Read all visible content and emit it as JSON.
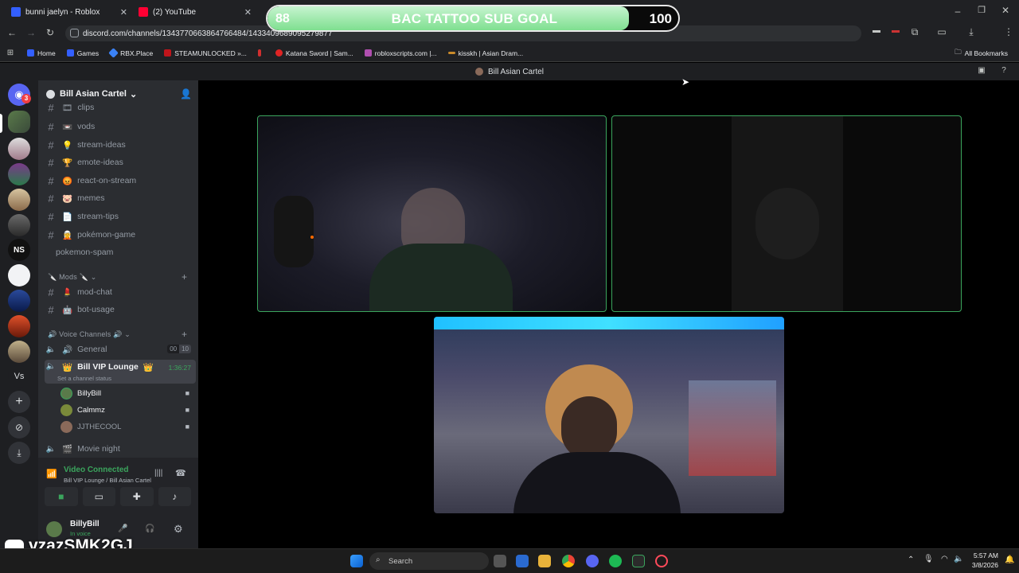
{
  "browser": {
    "tabs": [
      {
        "title": "bunni jaelyn - Roblox",
        "favicon_color": "#335fff"
      },
      {
        "title": "(2) YouTube",
        "favicon_color": "#ff0033"
      },
      {
        "title": "",
        "favicon_color": "#5865f2"
      }
    ],
    "url": "discord.com/channels/1343770663864766484/1433409689095279877",
    "bookmarks": [
      "Home",
      "Games",
      "RBX.Place",
      "STEAMUNLOCKED »...",
      "",
      "Katana Sword | Sam...",
      "robloxscripts.com |...",
      "kisskh | Asian Dram..."
    ],
    "all_bookmarks": "All Bookmarks"
  },
  "overlay": {
    "goal_current": "88",
    "goal_title": "BAC TATTOO SUB GOAL",
    "goal_target": "100",
    "progress": 0.88
  },
  "discord": {
    "window_title": "Bill Asian Cartel",
    "guild_mention_badge": "3",
    "guild_ns_label": "NS",
    "guild_vs_label": "Vs",
    "server_name": "Bill Asian Cartel",
    "channels": [
      {
        "icon": "🎞",
        "name": "clips"
      },
      {
        "icon": "📼",
        "name": "vods"
      },
      {
        "icon": "💡",
        "name": "stream-ideas"
      },
      {
        "icon": "🏆",
        "name": "emote-ideas"
      },
      {
        "icon": "😡",
        "name": "react-on-stream"
      },
      {
        "icon": "🐷",
        "name": "memes"
      },
      {
        "icon": "📄",
        "name": "stream-tips"
      },
      {
        "icon": "🧝",
        "name": "pokémon-game"
      },
      {
        "icon": "",
        "name": "pokemon-spam"
      }
    ],
    "mods_category": "Mods",
    "mod_channels": [
      {
        "icon": "💄",
        "name": "mod-chat"
      },
      {
        "icon": "🤖",
        "name": "bot-usage"
      }
    ],
    "voice_category": "Voice Channels",
    "voice_channels": {
      "general": {
        "name": "General",
        "count_a": "00",
        "count_b": "10"
      },
      "vip": {
        "name": "Bill VIP Lounge",
        "timer": "1:36:27",
        "status": "Set a channel status"
      },
      "movie": {
        "name": "Movie night"
      }
    },
    "voice_users": [
      {
        "name": "BillyBill",
        "avatar_color": "#5a7a4a"
      },
      {
        "name": "Calmmz",
        "avatar_color": "#7a8a3a"
      },
      {
        "name": "JJTHECOOL",
        "avatar_color": "#8a6a5a"
      }
    ],
    "connection": {
      "status": "Video Connected",
      "location": "Bill VIP Lounge / Bill Asian Cartel"
    },
    "user": {
      "name": "BillyBill",
      "status": "In voice"
    },
    "colors": {
      "accent_green": "#3ba55d",
      "blurple": "#5865f2"
    }
  },
  "watermark": "vzazSMK2GJ",
  "taskbar": {
    "search_placeholder": "Search",
    "time": "5:57 AM",
    "date": "3/8/2026"
  }
}
